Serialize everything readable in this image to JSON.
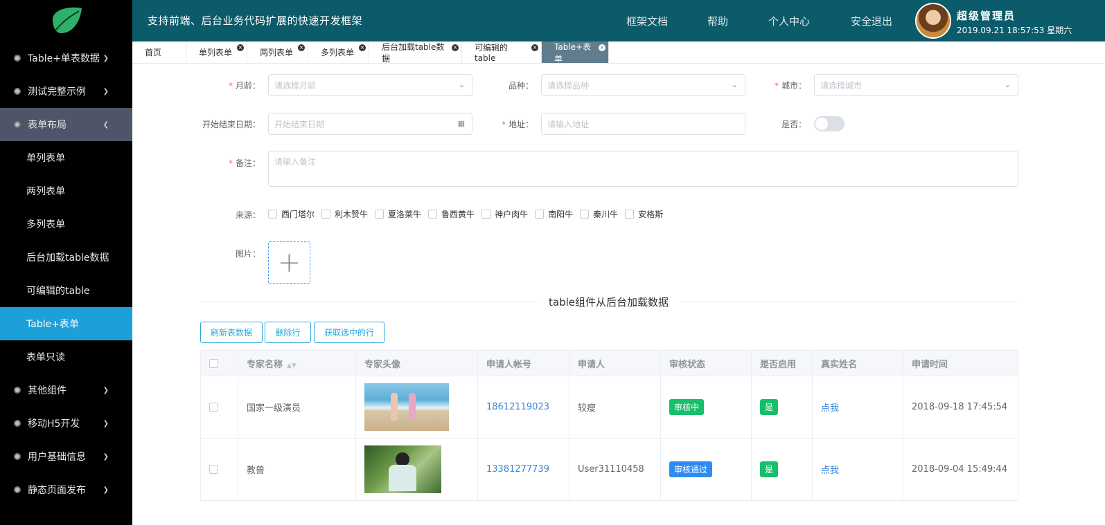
{
  "header": {
    "title": "支持前端、后台业务代码扩展的快速开发框架",
    "nav": [
      "框架文档",
      "帮助",
      "个人中心",
      "安全退出"
    ],
    "user_name": "超级管理员",
    "datetime": "2019.09.21 18:57:53 星期六"
  },
  "sidebar": {
    "menus": [
      {
        "label": "Table+单表数据"
      },
      {
        "label": "测试完整示例"
      },
      {
        "label": "表单布局"
      },
      {
        "label": "其他组件"
      },
      {
        "label": "移动H5开发"
      },
      {
        "label": "用户基础信息"
      },
      {
        "label": "静态页面发布"
      }
    ],
    "submenu": [
      "单列表单",
      "两列表单",
      "多列表单",
      "后台加载table数据",
      "可编辑的table",
      "Table+表单",
      "表单只读"
    ]
  },
  "tabs": [
    "首页",
    "单列表单",
    "两列表单",
    "多列表单",
    "后台加载table数据",
    "可编辑的table",
    "Table+表单"
  ],
  "form": {
    "age_label": "月龄：",
    "age_placeholder": "请选择月龄",
    "breed_label": "品种：",
    "breed_placeholder": "请选择品种",
    "city_label": "城市：",
    "city_placeholder": "请选择城市",
    "date_label": "开始结束日期：",
    "date_placeholder": "开始结束日期",
    "address_label": "地址：",
    "address_placeholder": "请输入地址",
    "yesno_label": "是否：",
    "remark_label": "备注：",
    "remark_placeholder": "请输入备注",
    "source_label": "来源：",
    "sources": [
      "西门塔尔",
      "利木赞牛",
      "夏洛莱牛",
      "鲁西黄牛",
      "神户肉牛",
      "南阳牛",
      "秦川牛",
      "安格斯"
    ],
    "image_label": "图片：",
    "upload_symbol": "+"
  },
  "section_title": "table组件从后台加载数据",
  "buttons": {
    "refresh": "刷新表数据",
    "delete": "删除行",
    "get_selected": "获取选中的行"
  },
  "table": {
    "columns": [
      "专家名称",
      "专家头像",
      "申请人帐号",
      "申请人",
      "审核状态",
      "是否启用",
      "真实姓名",
      "申请时间"
    ],
    "sort_icon": "▲▼",
    "rows": [
      {
        "name": "国家一级演员",
        "account": "18612119023",
        "applicant": "较瘦",
        "status": "审核中",
        "enabled": "是",
        "realname": "点我",
        "time": "2018-09-18 17:45:54"
      },
      {
        "name": "教兽",
        "account": "13381277739",
        "applicant": "User31110458",
        "status": "审核通过",
        "enabled": "是",
        "realname": "点我",
        "time": "2018-09-04 15:49:44"
      }
    ]
  },
  "colors": {
    "sidebar_bg": "#000000",
    "header_bg": "#0b5b6b",
    "active_submenu": "#1d9fd7",
    "expanded_menu": "#4e5568",
    "active_tab": "#5f7d8c",
    "tag_green": "#19be6b",
    "tag_blue": "#2d8cf0",
    "required": "#f56c6c"
  }
}
